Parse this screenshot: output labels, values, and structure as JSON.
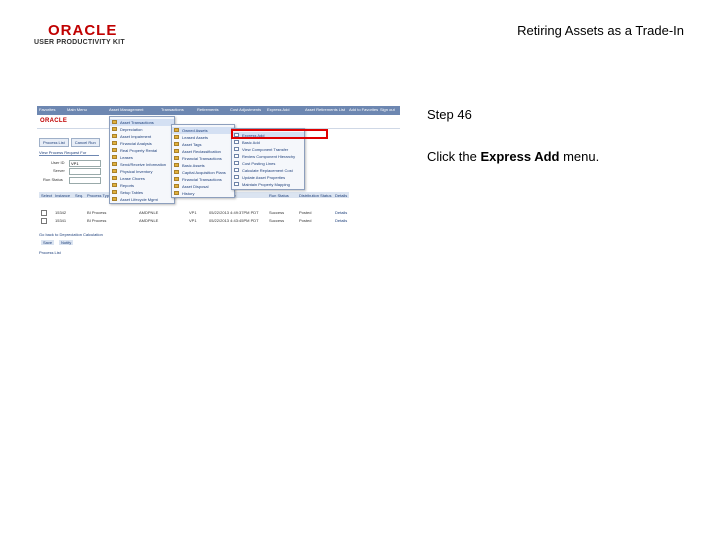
{
  "header": {
    "logo_text": "ORACLE",
    "logo_subtitle": "USER PRODUCTIVITY KIT",
    "document_title": "Retiring Assets as a Trade-In"
  },
  "step": {
    "label": "Step 46",
    "instruction_prefix": "Click the ",
    "instruction_target": "Express Add",
    "instruction_suffix": " menu."
  },
  "screenshot": {
    "nav": [
      "Favorites",
      "Main Menu",
      "Asset Management",
      "Transactions",
      "Retirements",
      "Cost Adjustments",
      "Express Add"
    ],
    "nav_right": [
      "Asset Retirements List",
      "Add to Favorites",
      "Sign out"
    ],
    "mini_logo": "ORACLE",
    "tabs": [
      "Process List",
      "Cancel Run"
    ],
    "section_title": "View Process Request For",
    "fields": [
      {
        "label": "User ID",
        "value": "VP1"
      },
      {
        "label": "Server",
        "value": ""
      },
      {
        "label": "Run Status",
        "value": ""
      }
    ],
    "menu1": [
      "Asset Transactions",
      "Depreciation",
      "Asset Impairment",
      "Financial Analysis",
      "Real Property Rental",
      "Leases",
      "Send/Receive Information",
      "Physical Inventory",
      "Lease Chores",
      "Reports",
      "Setup Tables",
      "Asset Lifecycle Mgmt"
    ],
    "menu2": [
      "Owned Assets",
      "Leased Assets",
      "Asset Tags",
      "Asset Reclassification",
      "Financial Transactions",
      "Basic Assets",
      "Capital Acquisition Plans",
      "Financial Transactions",
      "Asset Disposal",
      "History"
    ],
    "menu3": [
      "Express Add",
      "Basic Add",
      "View Component Transfer",
      "Review Component Hierarchy",
      "Cost Posting Lines",
      "Calculate Replacement Cost",
      "Update Asset Properties",
      "Maintain Property Mapping"
    ],
    "grid_header": [
      "Select",
      "Instance",
      "Seq.",
      "Process Type",
      "Process Name",
      "User",
      "Run Date/Time",
      "Run Status",
      "Distribution Status",
      "Details"
    ],
    "grid_rows": [
      [
        "15342",
        "BI Process",
        "AMDPNLE",
        "VP1",
        "05/22/2013 4:49:37PM PDT",
        "Success",
        "Posted",
        "Details"
      ],
      [
        "15341",
        "BI Process",
        "AMDPNLE",
        "VP1",
        "05/22/2013 4:43:45PM PDT",
        "Success",
        "Posted",
        "Details"
      ]
    ],
    "footer_links": [
      "Go back to Depreciation Calculation",
      "Save",
      "Notify",
      "Process List"
    ]
  },
  "colors": {
    "oracle_red": "#c00000",
    "highlight": "#e00000",
    "nav_blue": "#6d87b1"
  }
}
